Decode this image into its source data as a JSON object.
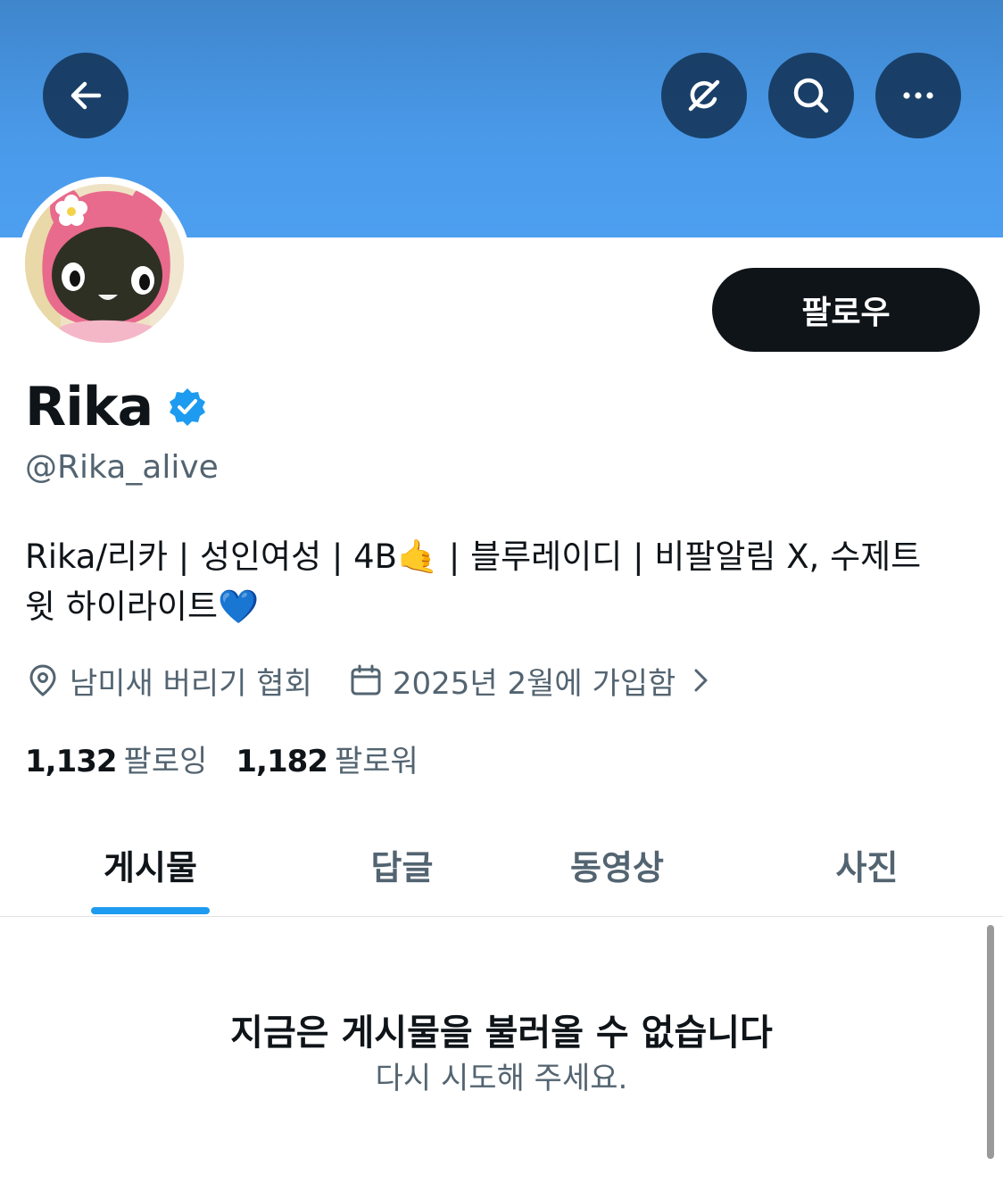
{
  "header": {
    "back_icon": "back-arrow-icon",
    "grok_icon": "grok-icon",
    "search_icon": "search-icon",
    "more_icon": "more-icon",
    "banner_color": "#4a9aea"
  },
  "profile": {
    "display_name": "Rika",
    "verified": true,
    "handle": "@Rika_alive",
    "follow_label": "팔로우",
    "bio_line1": "Rika/리카 | 성인여성 | 4B🤙 | 블루레이디 | 비팔알림 X, 수제트",
    "bio_line2": "윗 하이라이트💙",
    "location": "남미새 버리기 협회",
    "joined": "2025년 2월에 가입함"
  },
  "stats": {
    "following_count": "1,132",
    "following_label": "팔로잉",
    "followers_count": "1,182",
    "followers_label": "팔로워"
  },
  "tabs": [
    {
      "label": "게시물",
      "active": true
    },
    {
      "label": "답글",
      "active": false
    },
    {
      "label": "동영상",
      "active": false
    },
    {
      "label": "사진",
      "active": false
    }
  ],
  "empty_state": {
    "title": "지금은 게시물을 불러올 수 없습니다",
    "subtitle": "다시 시도해 주세요."
  }
}
